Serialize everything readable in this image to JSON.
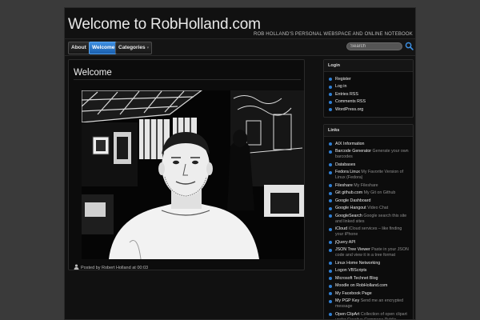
{
  "header": {
    "title": "Welcome to RobHolland.com",
    "description": "Rob Holland's personal webspace and online notebook"
  },
  "nav": {
    "tabs": [
      {
        "label": "About"
      },
      {
        "label": "Welcome"
      },
      {
        "label": "Categories"
      }
    ],
    "search_placeholder": "Search"
  },
  "post": {
    "title": "Welcome",
    "meta": "Posted by Robert Holland at 00:03"
  },
  "login": {
    "title": "Login",
    "items": [
      "Register",
      "Log in",
      "Entries RSS",
      "Comments RSS",
      "WordPress.org"
    ]
  },
  "links": {
    "title": "Links",
    "items": [
      {
        "label": "AIX Information",
        "desc": ""
      },
      {
        "label": "Barcode Generator",
        "desc": "Generate your own barcodes"
      },
      {
        "label": "Databases",
        "desc": ""
      },
      {
        "label": "Fedora Linux",
        "desc": "My Favorite Version of Linux (Fedora)"
      },
      {
        "label": "Fileshare",
        "desc": "My Fileshare"
      },
      {
        "label": "Git github.com",
        "desc": "My Git on Github"
      },
      {
        "label": "Google Dashboard",
        "desc": ""
      },
      {
        "label": "Google Hangout",
        "desc": "Video Chat"
      },
      {
        "label": "GoogleSearch",
        "desc": "Google search this site and linked sites"
      },
      {
        "label": "iCloud",
        "desc": "iCloud services – like finding your iPhone"
      },
      {
        "label": "jQuery API",
        "desc": ""
      },
      {
        "label": "JSON Tree Viewer",
        "desc": "Paste in your JSON code and view it in a tree format"
      },
      {
        "label": "Linux Home Networking",
        "desc": ""
      },
      {
        "label": "Logon VBScripts",
        "desc": ""
      },
      {
        "label": "Microsoft Technet Blog",
        "desc": ""
      },
      {
        "label": "Moodle on RobHolland.com",
        "desc": ""
      },
      {
        "label": "My Facebook Page",
        "desc": ""
      },
      {
        "label": "My PGP Key",
        "desc": "Send me an encrypted message"
      },
      {
        "label": "Open ClipArt",
        "desc": "Collection of open clipart under Creative Commons Public License"
      }
    ]
  },
  "colors": {
    "accent": "#2f7fd4",
    "active_tab": "#2a78c8",
    "background": "#3a3a3a",
    "panel": "#0c0c0c"
  }
}
